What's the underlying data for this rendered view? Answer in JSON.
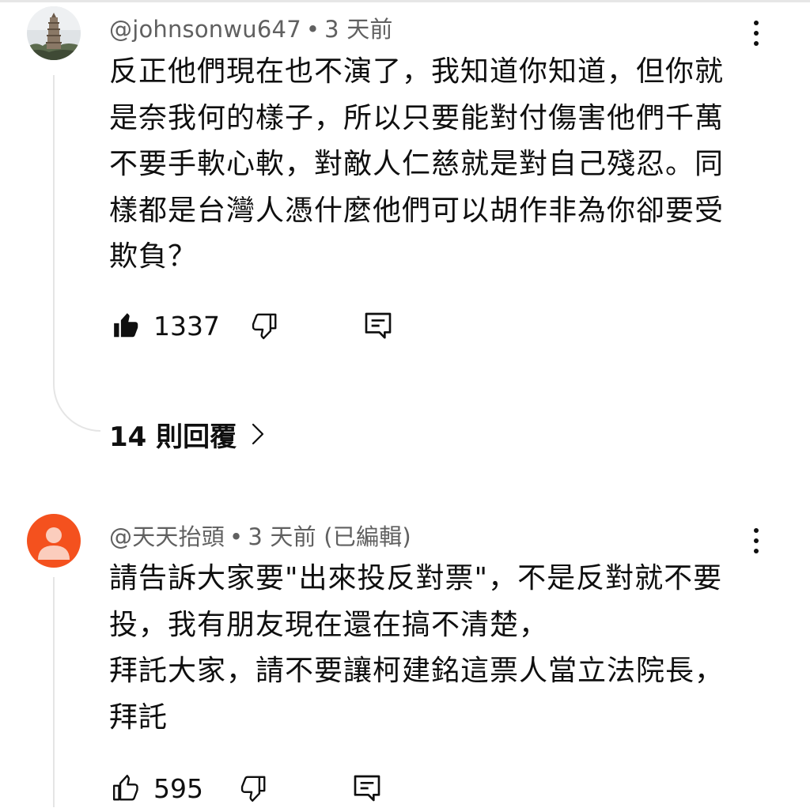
{
  "comments": [
    {
      "author": "@johnsonwu647",
      "separator": "•",
      "time": "3 天前",
      "edited": "",
      "text": "反正他們現在也不演了，我知道你知道，但你就是奈我何的樣子，所以只要能對付傷害他們千萬不要手軟心軟，對敵人仁慈就是對自己殘忍。同樣都是台灣人憑什麼他們可以胡作非為你卻要受欺負？",
      "likes": "1337",
      "liked": true,
      "avatar_icon": "pagoda-photo-avatar"
    },
    {
      "author": "@天天抬頭",
      "separator": "•",
      "time": "3 天前",
      "edited": "(已編輯)",
      "text": "請告訴大家要\"出來投反對票\"，不是反對就不要投，我有朋友現在還在搞不清楚，\n拜託大家，請不要讓柯建銘這票人當立法院長，拜託",
      "likes": "595",
      "liked": false,
      "avatar_icon": "default-user-avatar",
      "avatar_color": "#f4511e"
    }
  ],
  "replies": {
    "label": "14 則回覆"
  },
  "icons": {
    "like": "thumbs-up-icon",
    "dislike": "thumbs-down-icon",
    "reply": "reply-icon",
    "more": "more-vertical-icon",
    "chevron": "chevron-right-icon"
  }
}
